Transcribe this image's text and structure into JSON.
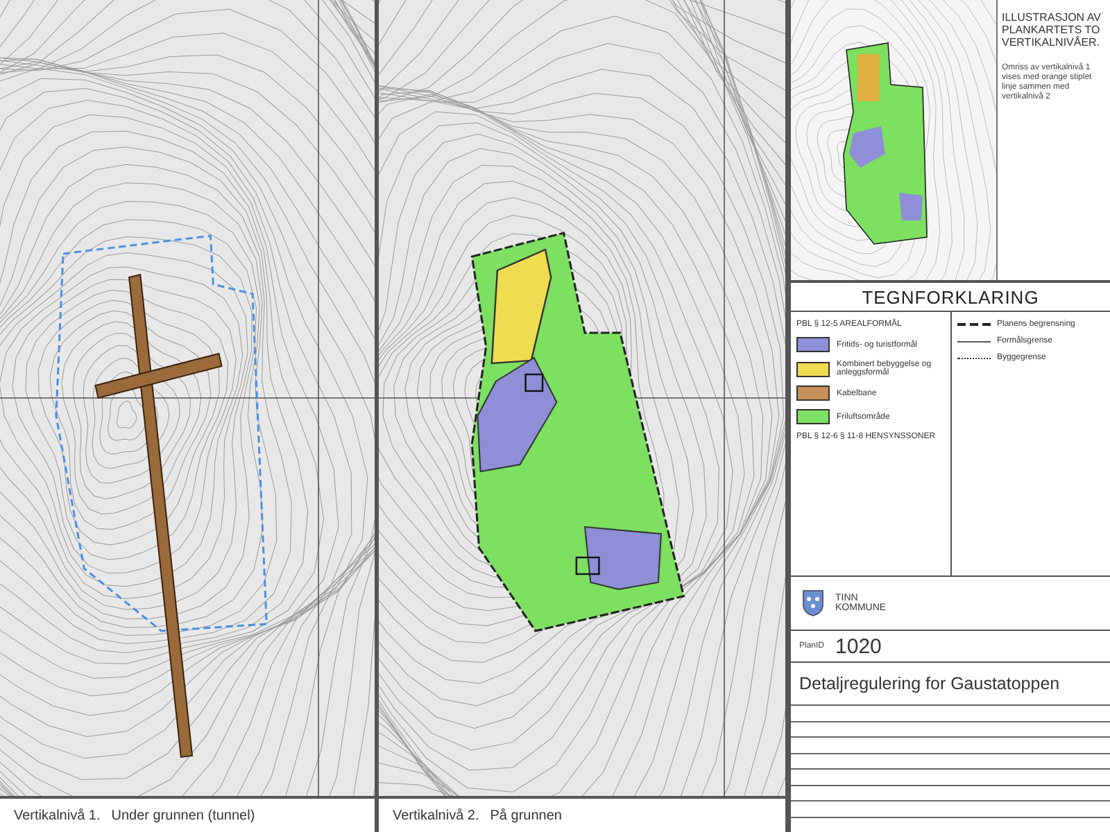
{
  "panels": [
    {
      "kind": "tunnel",
      "level_label": "Vertikalnivå 1.",
      "caption": "Under grunnen (tunnel)"
    },
    {
      "kind": "surface",
      "level_label": "Vertikalnivå 2.",
      "caption": "På grunnen"
    }
  ],
  "illustration": {
    "title": "ILLUSTRASJON AV PLANKARTETS TO VERTIKALNIVÅER.",
    "note": "Omriss av vertikalnivå 1 vises med orange stiplet linje sammen med vertikalnivå 2"
  },
  "legend": {
    "title": "TEGNFORKLARING",
    "section": "PBL § 12-5 AREALFORMÅL",
    "areas": [
      {
        "label": "Fritids- og turistformål",
        "color": "#8e8fd6"
      },
      {
        "label": "Kombinert bebyggelse og anleggsformål",
        "color": "#f0dc50"
      },
      {
        "label": "Kabelbane",
        "color": "#c8915a"
      },
      {
        "label": "Friluftsområde",
        "color": "#7de060"
      }
    ],
    "section_2": "PBL § 12-6 § 11-8 HENSYNSSONER",
    "lines": [
      {
        "kind": "dashed",
        "label": "Planens begrensning"
      },
      {
        "kind": "thin",
        "label": "Formålsgrense"
      },
      {
        "kind": "dotted",
        "label": "Byggegrense"
      }
    ]
  },
  "municipality": "TINN KOMMUNE",
  "plan_id_label": "PlanID",
  "plan_id": "1020",
  "plan_title": "Detaljregulering for Gaustatoppen"
}
